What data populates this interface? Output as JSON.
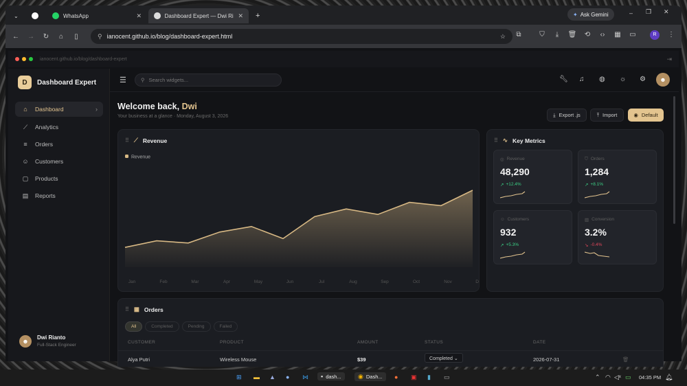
{
  "browser": {
    "tabs": [
      {
        "label": "WhatsApp"
      },
      {
        "label": "Dashboard Expert — Dwi Rianto"
      }
    ],
    "url": "ianocent.github.io/blog/dashboard-expert.html",
    "gemini": "Ask Gemini",
    "profile": "R"
  },
  "app": {
    "bar_url": "ianocent.github.io/blog/dashboard-expert",
    "brand_logo": "D",
    "brand_name": "Dashboard Expert",
    "nav": [
      {
        "label": "Dashboard",
        "icon": "home-icon"
      },
      {
        "label": "Analytics",
        "icon": "chart-line-icon"
      },
      {
        "label": "Orders",
        "icon": "list-icon"
      },
      {
        "label": "Customers",
        "icon": "users-icon"
      },
      {
        "label": "Products",
        "icon": "box-icon"
      },
      {
        "label": "Reports",
        "icon": "document-icon"
      }
    ],
    "user": {
      "name": "Dwi Rianto",
      "role": "Full-Stack Engineer"
    },
    "search_placeholder": "Search widgets...",
    "welcome_prefix": "Welcome back, ",
    "welcome_name": "Dwi",
    "subtitle": "Your business at a glance · Monday, August 3, 2026",
    "buttons": {
      "export": "Export .js",
      "import": "Import",
      "theme": "Default"
    },
    "revenue_card": {
      "title": "Revenue"
    },
    "metrics": {
      "title": "Key Metrics",
      "items": [
        {
          "label": "Revenue",
          "value": "48,290",
          "delta": "+12.4%",
          "trend": "up"
        },
        {
          "label": "Orders",
          "value": "1,284",
          "delta": "+8.1%",
          "trend": "up"
        },
        {
          "label": "Customers",
          "value": "932",
          "delta": "+5.3%",
          "trend": "up"
        },
        {
          "label": "Conversion",
          "value": "3.2%",
          "delta": "-0.4%",
          "trend": "down"
        }
      ]
    },
    "orders": {
      "title": "Orders",
      "filters": [
        "All",
        "Completed",
        "Pending",
        "Failed"
      ],
      "columns": [
        "CUSTOMER",
        "PRODUCT",
        "AMOUNT",
        "STATUS",
        "DATE"
      ],
      "rows": [
        {
          "customer": "Alya Putri",
          "product": "Wireless Mouse",
          "amount": "$39",
          "status": "Completed",
          "date": "2026-07-31"
        }
      ]
    }
  },
  "chart_data": {
    "type": "area",
    "categories": [
      "Jan",
      "Feb",
      "Mar",
      "Apr",
      "May",
      "Jun",
      "Jul",
      "Aug",
      "Sep",
      "Oct",
      "Nov",
      "Dec"
    ],
    "series": [
      {
        "name": "Revenue",
        "values": [
          18,
          24,
          22,
          32,
          37,
          26,
          46,
          53,
          48,
          59,
          56,
          70
        ]
      }
    ],
    "ylim": [
      0,
      100
    ],
    "legend": "top-left",
    "grid": false,
    "color": "#d7b884"
  },
  "taskbar": {
    "apps": [
      "dash...",
      "Dash..."
    ],
    "time": "04:35 PM"
  },
  "colors": {
    "accent": "#e3c48f",
    "up": "#3ccf85",
    "down": "#e0475b"
  }
}
